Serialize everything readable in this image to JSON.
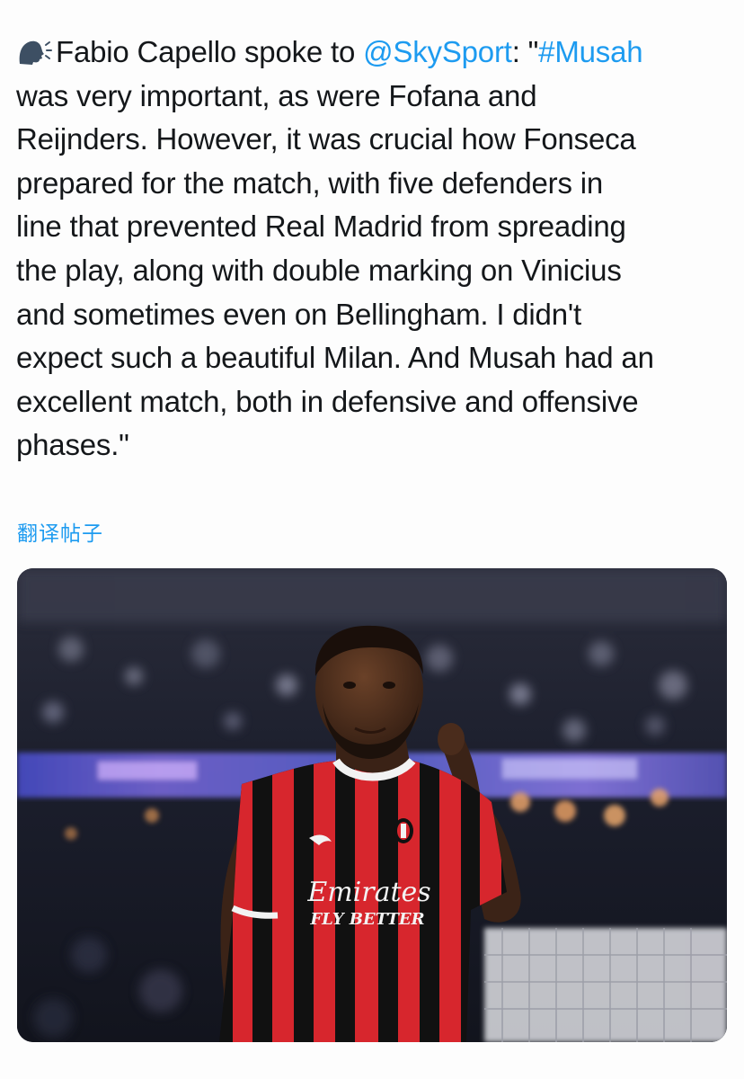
{
  "post": {
    "speaker_icon": "speaking-head-icon",
    "text_before_mention": "Fabio Capello spoke to ",
    "mention": "@SkySport",
    "text_between": ": \"",
    "hashtag": "#Musah",
    "text_after_hashtag": "\nwas very important, as were Fofana and\nReijnders. However, it was crucial how Fonseca\nprepared for the match, with five defenders in\nline that prevented Real Madrid from spreading\nthe play, along with double marking on Vinicius\nand sometimes even on Bellingham. I didn't\nexpect such a beautiful Milan. And Musah had an\nexcellent match, both in defensive and offensive\nphases.\""
  },
  "translate": {
    "label": "翻译帖子"
  },
  "media": {
    "jersey_sponsor_line1": "Emirates",
    "jersey_sponsor_line2": "FLY BETTER",
    "colors": {
      "jersey_red": "#d7262d",
      "jersey_black": "#111111",
      "link_blue": "#1d9bf0"
    }
  }
}
